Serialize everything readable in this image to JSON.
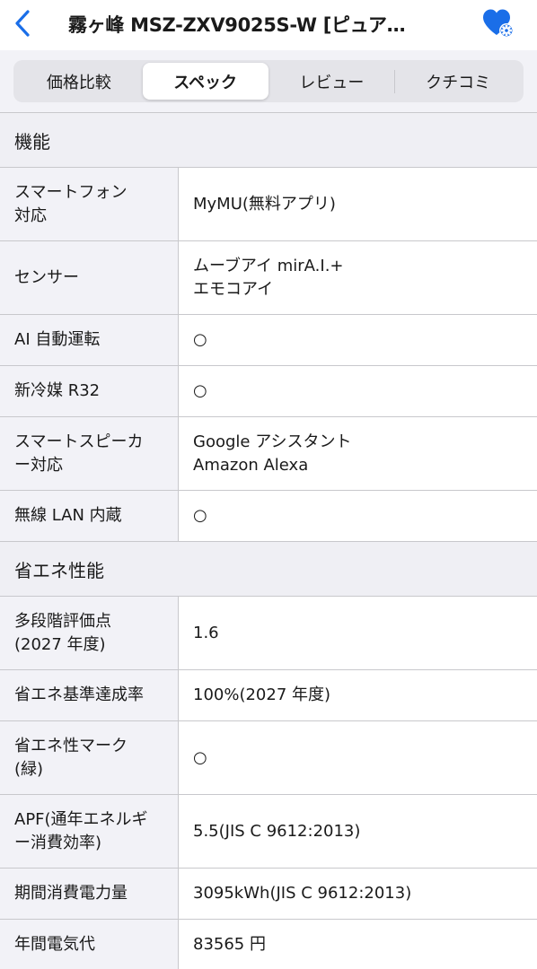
{
  "header": {
    "title": "霧ヶ峰 MSZ-ZXV9025S-W [ピュア…",
    "back_icon": "chevron-left-icon",
    "favorite_icon": "heart-gear-icon",
    "accent_color": "#1a6ee8"
  },
  "tabs": [
    {
      "label": "価格比較",
      "active": false
    },
    {
      "label": "スペック",
      "active": true
    },
    {
      "label": "レビュー",
      "active": false
    },
    {
      "label": "クチコミ",
      "active": false
    }
  ],
  "sections": [
    {
      "title": "機能",
      "rows": [
        {
          "label": "スマートフォン\n対応",
          "value": "MyMU(無料アプリ)"
        },
        {
          "label": "センサー",
          "value": "ムーブアイ mirA.I.+\nエモコアイ"
        },
        {
          "label": "AI 自動運転",
          "value": "○"
        },
        {
          "label": "新冷媒 R32",
          "value": "○"
        },
        {
          "label": "スマートスピーカ\nー対応",
          "value": "Google アシスタント\nAmazon Alexa"
        },
        {
          "label": "無線 LAN 内蔵",
          "value": "○"
        }
      ]
    },
    {
      "title": "省エネ性能",
      "rows": [
        {
          "label": "多段階評価点\n(2027 年度)",
          "value": "1.6"
        },
        {
          "label": "省エネ基準達成率",
          "value": "100%(2027 年度)"
        },
        {
          "label": "省エネ性マーク\n(緑)",
          "value": "○"
        },
        {
          "label": "APF(通年エネルギ\nー消費効率)",
          "value": "5.5(JIS C 9612:2013)"
        },
        {
          "label": "期間消費電力量",
          "value": "3095kWh(JIS C 9612:2013)"
        },
        {
          "label": "年間電気代",
          "value": "83565 円"
        }
      ]
    }
  ]
}
